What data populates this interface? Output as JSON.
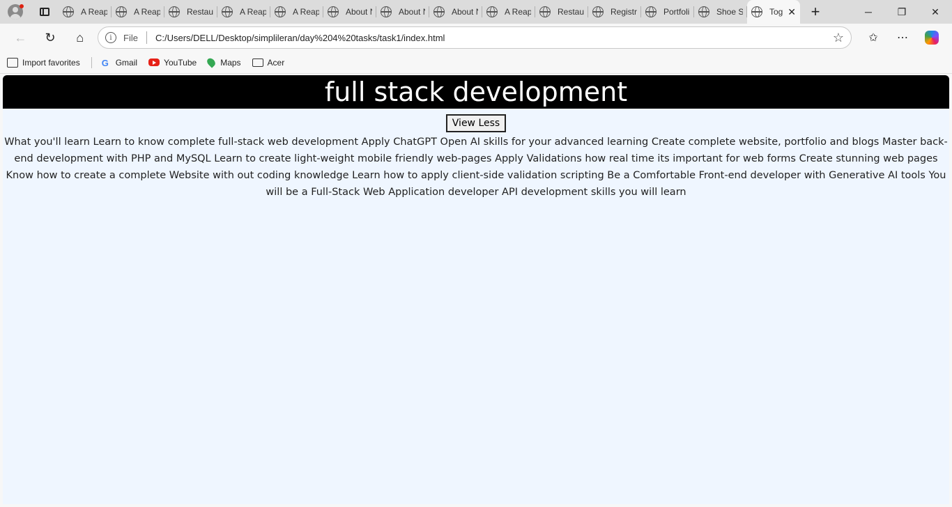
{
  "browser": {
    "tabs": [
      {
        "title": "A Reapo"
      },
      {
        "title": "A Reapo"
      },
      {
        "title": "Restaura"
      },
      {
        "title": "A Reapo"
      },
      {
        "title": "A Reapo"
      },
      {
        "title": "About N"
      },
      {
        "title": "About N"
      },
      {
        "title": "About N"
      },
      {
        "title": "A Reapo"
      },
      {
        "title": "Restaura"
      },
      {
        "title": "Registra"
      },
      {
        "title": "Portfoli"
      },
      {
        "title": "Shoe Sh"
      },
      {
        "title": "Tog"
      }
    ],
    "address": {
      "protocol_label": "File",
      "url": "C:/Users/DELL/Desktop/simplileran/day%204%20tasks/task1/index.html"
    },
    "bookmarks": [
      {
        "label": "Import favorites",
        "icon": "import-icon"
      },
      {
        "label": "Gmail",
        "icon": "google-icon"
      },
      {
        "label": "YouTube",
        "icon": "youtube-icon"
      },
      {
        "label": "Maps",
        "icon": "maps-icon"
      },
      {
        "label": "Acer",
        "icon": "folder-icon"
      }
    ]
  },
  "page": {
    "heading": "full stack development",
    "toggle_label": "View Less",
    "body_text": "What you'll learn Learn to know complete full-stack web development Apply ChatGPT Open AI skills for your advanced learning Create complete website, portfolio and blogs Master back-end development with PHP and MySQL Learn to create light-weight mobile friendly web-pages Apply Validations how real time its important for web forms Create stunning web pages Know how to create a complete Website with out coding knowledge Learn how to apply client-side validation scripting Be a Comfortable Front-end developer with Generative AI tools You will be a Full-Stack Web Application developer API development skills you will learn"
  },
  "colors": {
    "header_bg": "#000000",
    "page_bg": "#eff6ff"
  }
}
